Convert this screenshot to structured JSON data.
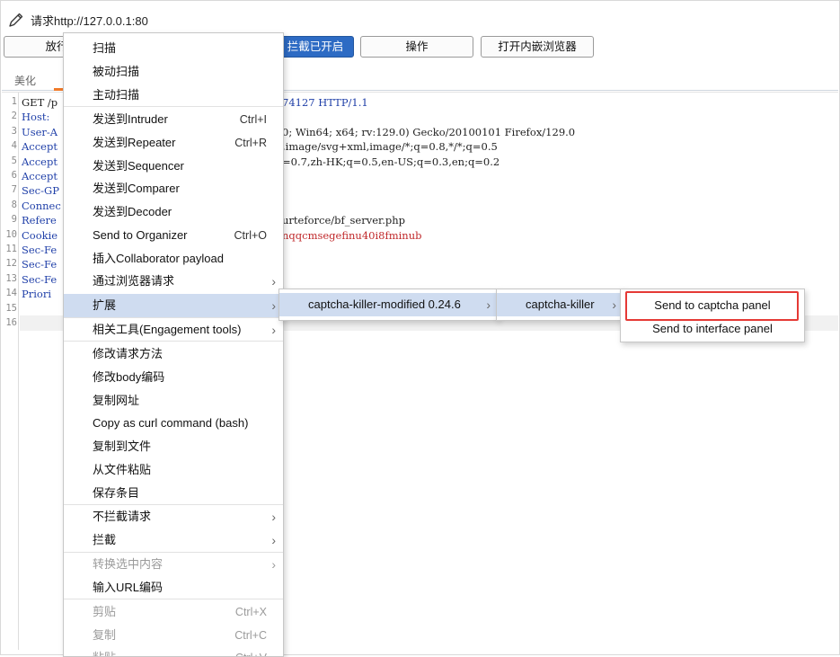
{
  "window": {
    "title": "请求http://127.0.0.1:80"
  },
  "toolbar": {
    "release_label": "放行",
    "intercept_label": "拦截已开启",
    "action_label": "操作",
    "browser_label": "打开内嵌浏览器"
  },
  "tabs": {
    "pretty": "美化"
  },
  "editor": {
    "line_numbers": [
      "1",
      "2",
      "3",
      "4",
      "5",
      "6",
      "7",
      "8",
      "9",
      "10",
      "11",
      "12",
      "13",
      "14",
      "15",
      "16"
    ],
    "lines": [
      {
        "key": "GET /p",
        "value": "74127 HTTP/1.1"
      },
      {
        "key": "Host:",
        "value": ""
      },
      {
        "key": "User-A",
        "value": "0; Win64; x64; rv:129.0) Gecko/20100101 Firefox/129.0"
      },
      {
        "key": "Accept",
        "value": ",image/svg+xml,image/*;q=0.8,*/*;q=0.5"
      },
      {
        "key": "Accept",
        "value": "=0.7,zh-HK;q=0.5,en-US;q=0.3,en;q=0.2"
      },
      {
        "key": "Accept",
        "value": ""
      },
      {
        "key": "Sec-GP",
        "value": ""
      },
      {
        "key": "Connec",
        "value": ""
      },
      {
        "key": "Refere",
        "value": "urteforce/bf_server.php"
      },
      {
        "key": "Cookie",
        "value": "nqqcmsegefinu40i8fminub"
      },
      {
        "key": "Sec-Fe",
        "value": ""
      },
      {
        "key": "Sec-Fe",
        "value": ""
      },
      {
        "key": "Sec-Fe",
        "value": ""
      },
      {
        "key": "Priori",
        "value": ""
      },
      {
        "key": "",
        "value": ""
      },
      {
        "key": "",
        "value": ""
      }
    ]
  },
  "menu": {
    "items": [
      {
        "label": "扫描"
      },
      {
        "label": "被动扫描"
      },
      {
        "label": "主动扫描"
      },
      {
        "label": "发送到Intruder",
        "shortcut": "Ctrl+I"
      },
      {
        "label": "发送到Repeater",
        "shortcut": "Ctrl+R"
      },
      {
        "label": "发送到Sequencer"
      },
      {
        "label": "发送到Comparer"
      },
      {
        "label": "发送到Decoder"
      },
      {
        "label": "Send to Organizer",
        "shortcut": "Ctrl+O"
      },
      {
        "label": "插入Collaborator payload"
      },
      {
        "label": "通过浏览器请求"
      },
      {
        "label": "扩展"
      },
      {
        "label": "相关工具(Engagement tools)"
      },
      {
        "label": "修改请求方法"
      },
      {
        "label": "修改body编码"
      },
      {
        "label": "复制网址"
      },
      {
        "label": "Copy as curl command (bash)"
      },
      {
        "label": "复制到文件"
      },
      {
        "label": "从文件粘贴"
      },
      {
        "label": "保存条目"
      },
      {
        "label": "不拦截请求"
      },
      {
        "label": "拦截"
      },
      {
        "label": "转换选中内容"
      },
      {
        "label": "输入URL编码"
      },
      {
        "label": "剪贴",
        "shortcut": "Ctrl+X"
      },
      {
        "label": "复制",
        "shortcut": "Ctrl+C"
      },
      {
        "label": "粘贴",
        "shortcut": "Ctrl+V"
      }
    ]
  },
  "submenu_extensions": {
    "item": "captcha-killer-modified 0.24.6"
  },
  "submenu_captcha": {
    "item": "captcha-killer"
  },
  "submenu_actions": {
    "send_captcha": "Send to captcha panel",
    "send_interface": "Send to interface panel"
  },
  "colors": {
    "accent": "#2d6bc4",
    "highlight": "#cfdcf0",
    "redbox": "#e53935",
    "tab_underline": "#f07a2a"
  }
}
